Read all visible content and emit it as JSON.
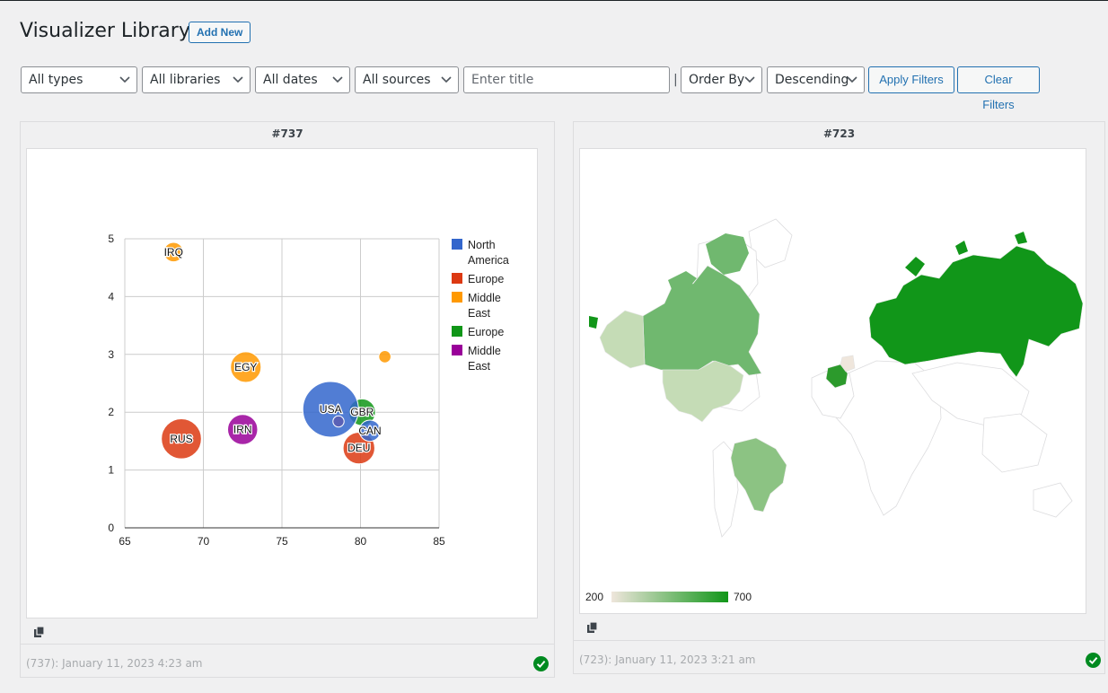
{
  "page": {
    "title": "Visualizer Library",
    "add_new": "Add New"
  },
  "filters": {
    "types": "All types",
    "libraries": "All libraries",
    "dates": "All dates",
    "sources": "All sources",
    "title_placeholder": "Enter title",
    "separator": "|",
    "order_by": "Order By",
    "direction": "Descending",
    "apply": "Apply Filters",
    "clear": "Clear Filters"
  },
  "cards": [
    {
      "id_label": "#737",
      "footer": "(737): January 11, 2023 4:23 am",
      "status": "published"
    },
    {
      "id_label": "#723",
      "footer": "(723): January 11, 2023 3:21 am",
      "status": "published"
    }
  ],
  "colors": {
    "accent": "#2271b1",
    "success": "#008a20"
  },
  "chart_data": [
    {
      "type": "scatter",
      "subtype": "bubble",
      "xlim": [
        65,
        85
      ],
      "ylim": [
        0,
        5
      ],
      "x_ticks": [
        65,
        70,
        75,
        80,
        85
      ],
      "y_ticks": [
        0,
        1,
        2,
        3,
        4,
        5
      ],
      "grid": true,
      "legend_position": "right",
      "legend": [
        {
          "label": [
            "North",
            "America"
          ],
          "color": "#3366cc"
        },
        {
          "label": [
            "Europe"
          ],
          "color": "#dc3912"
        },
        {
          "label": [
            "Middle",
            "East"
          ],
          "color": "#ff9900"
        },
        {
          "label": [
            "Europe"
          ],
          "color": "#109618"
        },
        {
          "label": [
            "Middle",
            "East"
          ],
          "color": "#990099"
        }
      ],
      "points": [
        {
          "label": "IRQ",
          "x": 68.1,
          "y": 4.77,
          "size": 0.35,
          "color": "#ff9900"
        },
        {
          "label": "EGY",
          "x": 72.7,
          "y": 2.78,
          "size": 0.55,
          "color": "#ff9900"
        },
        {
          "label": "",
          "x": 81.55,
          "y": 2.96,
          "size": 0.22,
          "color": "#ff9900"
        },
        {
          "label": "RUS",
          "x": 68.6,
          "y": 1.54,
          "size": 0.72,
          "color": "#dc3912"
        },
        {
          "label": "IRN",
          "x": 72.5,
          "y": 1.7,
          "size": 0.54,
          "color": "#990099"
        },
        {
          "label": "DEU",
          "x": 79.9,
          "y": 1.38,
          "size": 0.57,
          "color": "#dc3912"
        },
        {
          "label": "GBR",
          "x": 80.1,
          "y": 2.0,
          "size": 0.48,
          "color": "#109618"
        },
        {
          "label": "CAN",
          "x": 80.6,
          "y": 1.68,
          "size": 0.38,
          "color": "#3366cc"
        },
        {
          "label": "USA",
          "x": 78.1,
          "y": 2.05,
          "size": 1.0,
          "color": "#3366cc"
        },
        {
          "label": "",
          "x": 78.6,
          "y": 1.84,
          "size": 0.2,
          "color": "#5c5cb0"
        }
      ]
    },
    {
      "type": "geo",
      "color_axis": {
        "min": 200,
        "max": 700,
        "min_color": "#efe6dc",
        "max_color": "#109618"
      },
      "regions": [
        {
          "name": "Russia",
          "value": 700
        },
        {
          "name": "France",
          "value": 600
        },
        {
          "name": "Canada",
          "value": 500
        },
        {
          "name": "Brazil",
          "value": 400
        },
        {
          "name": "United States",
          "value": 300
        },
        {
          "name": "Germany",
          "value": 200
        }
      ]
    }
  ]
}
